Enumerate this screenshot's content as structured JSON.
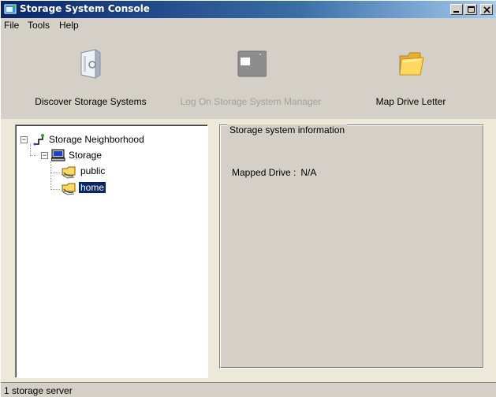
{
  "window": {
    "title": "Storage System Console"
  },
  "menu": [
    "File",
    "Tools",
    "Help"
  ],
  "toolbar": {
    "discover_label": "Discover Storage Systems",
    "logon_label": "Log On Storage System Manager",
    "mapdrive_label": "Map Drive Letter",
    "discover_icon": "server-icon",
    "logon_icon": "console-window-icon",
    "mapdrive_icon": "folder-icon"
  },
  "tree": {
    "root": "Storage Neighborhood",
    "server": "Storage",
    "shares": [
      "public",
      "home"
    ],
    "selected": "home"
  },
  "info": {
    "group_title": "Storage system information",
    "mapped_drive_label": "Mapped Drive :",
    "mapped_drive_value": "N/A"
  },
  "status": {
    "text": "1 storage server"
  },
  "colors": {
    "title_start": "#0a246a",
    "title_end": "#a6caf0",
    "face": "#d4d0c8",
    "selection": "#0a246a"
  }
}
